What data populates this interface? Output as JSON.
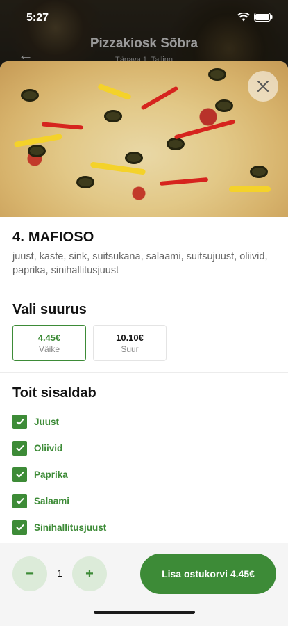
{
  "status_bar": {
    "time": "5:27"
  },
  "background_header": {
    "title": "Pizzakiosk Sõbra",
    "subtitle": "Tänava 1, Tallinn"
  },
  "product": {
    "title": "4. MAFIOSO",
    "description": "juust, kaste, sink, suitsukana, salaami, suitsujuust, oliivid, paprika, sinihallitusjuust"
  },
  "size_section": {
    "title": "Vali suurus",
    "options": [
      {
        "price": "4.45€",
        "name": "Väike",
        "selected": true
      },
      {
        "price": "10.10€",
        "name": "Suur",
        "selected": false
      }
    ]
  },
  "ingredients_section": {
    "title": "Toit sisaldab",
    "items": [
      {
        "label": "Juust",
        "checked": true
      },
      {
        "label": "Oliivid",
        "checked": true
      },
      {
        "label": "Paprika",
        "checked": true
      },
      {
        "label": "Salaami",
        "checked": true
      },
      {
        "label": "Sinihallitusjuust",
        "checked": true
      }
    ]
  },
  "cart": {
    "quantity": "1",
    "decrement_label": "−",
    "increment_label": "+",
    "add_button_label": "Lisa ostukorvi 4.45€"
  },
  "colors": {
    "accent": "#3d8b37",
    "accent_light": "#dcebd9"
  }
}
